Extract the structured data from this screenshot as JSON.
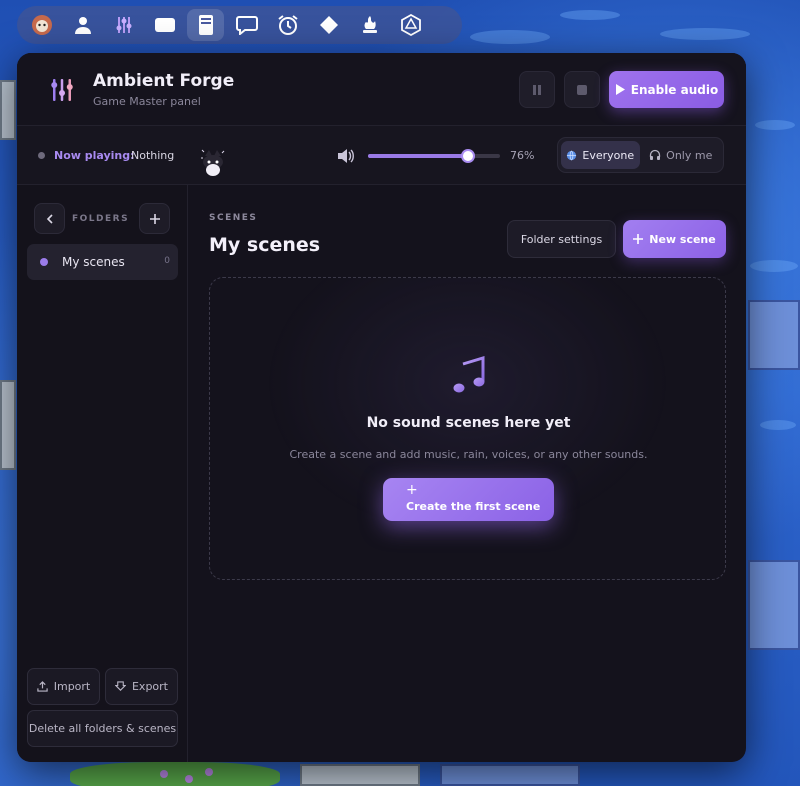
{
  "toolbar": {
    "tools": [
      "token-icon",
      "user-icon",
      "sliders-icon",
      "card-icon",
      "book-icon",
      "chat-icon",
      "alarm-icon",
      "diamond-icon",
      "fire-hand-icon",
      "d20-icon"
    ]
  },
  "header": {
    "title": "Ambient Forge",
    "subtitle": "Game Master panel",
    "enable_audio": "Enable audio"
  },
  "now_playing": {
    "label": "Now playing:",
    "value": "Nothing",
    "volume_percent": 76,
    "volume_text": "76%",
    "audience_options": [
      "Everyone",
      "Only me"
    ],
    "audience_selected": "Everyone"
  },
  "sidebar": {
    "label": "FOLDERS",
    "folders": [
      {
        "name": "My scenes",
        "count": "0"
      }
    ],
    "import": "Import",
    "export": "Export",
    "delete_all": "Delete all folders & scenes"
  },
  "main": {
    "kicker": "SCENES",
    "title": "My scenes",
    "folder_settings": "Folder settings",
    "new_scene": "New scene",
    "empty_title": "No sound scenes here yet",
    "empty_sub": "Create a scene and add music, rain, voices, or any other sounds.",
    "create_plus": "+",
    "create_first": "Create the first scene"
  },
  "colors": {
    "accent": "#9a73ec",
    "panel": "#14121c"
  }
}
